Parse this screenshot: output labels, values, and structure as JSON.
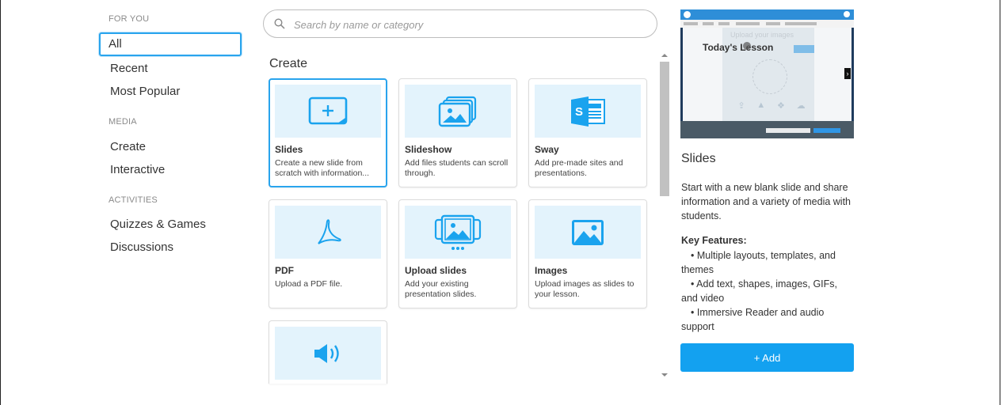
{
  "sidebar": {
    "sections": [
      {
        "heading": "FOR YOU",
        "items": [
          {
            "label": "All"
          },
          {
            "label": "Recent"
          },
          {
            "label": "Most Popular"
          }
        ]
      },
      {
        "heading": "MEDIA",
        "items": [
          {
            "label": "Create"
          },
          {
            "label": "Interactive"
          }
        ]
      },
      {
        "heading": "ACTIVITIES",
        "items": [
          {
            "label": "Quizzes & Games"
          },
          {
            "label": "Discussions"
          }
        ]
      }
    ],
    "selected": "All"
  },
  "search": {
    "placeholder": "Search by name or category",
    "value": ""
  },
  "main": {
    "section_title": "Create",
    "cards": [
      {
        "title": "Slides",
        "description": "Create a new slide from scratch with information...",
        "icon": "new-slide-icon",
        "selected": true
      },
      {
        "title": "Slideshow",
        "description": "Add files students can scroll through.",
        "icon": "slideshow-icon"
      },
      {
        "title": "Sway",
        "description": "Add pre-made sites and presentations.",
        "icon": "sway-icon"
      },
      {
        "title": "PDF",
        "description": "Upload a PDF file.",
        "icon": "pdf-icon"
      },
      {
        "title": "Upload slides",
        "description": "Add your existing presentation slides.",
        "icon": "upload-slides-icon"
      },
      {
        "title": "Images",
        "description": "Upload images as slides to your lesson.",
        "icon": "image-icon"
      },
      {
        "title": "",
        "description": "",
        "icon": "audio-icon"
      }
    ]
  },
  "preview": {
    "lesson_title": "Today's Lesson",
    "overlay_text": "Upload your images",
    "title": "Slides",
    "description": "Start with a new blank slide and share information and a variety of media with students.",
    "features_heading": "Key Features:",
    "features": [
      "• Multiple layouts, templates, and themes",
      "• Add text, shapes, images, GIFs, and video",
      "• Immersive Reader and audio support"
    ],
    "add_label": "+ Add"
  },
  "colors": {
    "accent": "#13a1f0",
    "card_thumb_bg": "#e3f3fc",
    "selected_border": "#29a4ed",
    "icon_blue": "#1aa3ee"
  }
}
